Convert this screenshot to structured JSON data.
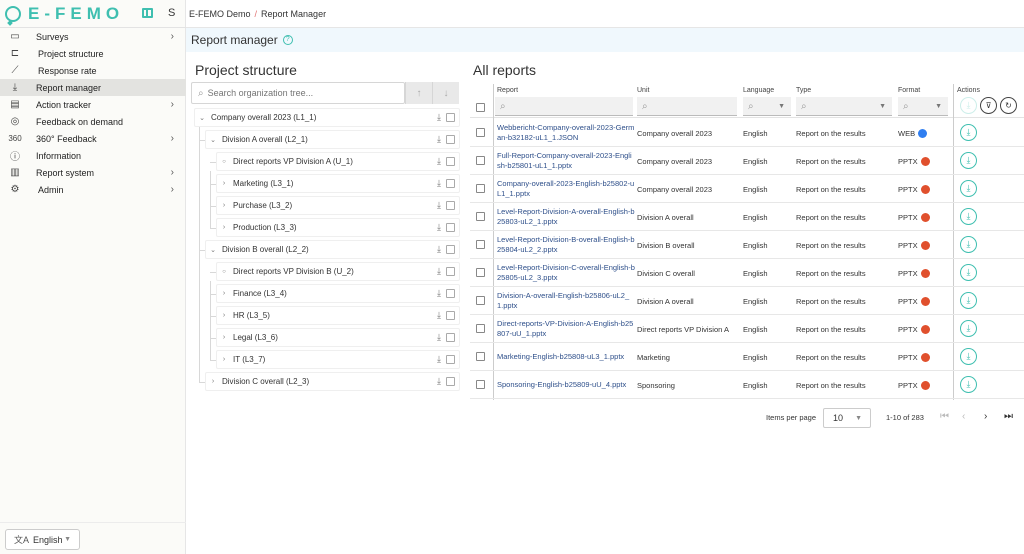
{
  "app": {
    "name": "E-FEMO",
    "user_initial": "S"
  },
  "breadcrumb": {
    "root": "E-FEMO Demo",
    "separator": "/",
    "current": "Report Manager"
  },
  "page_title": "Report manager",
  "sidebar": {
    "items": [
      {
        "label": "Surveys",
        "icon": "folder-icon",
        "has_children": true,
        "active": false
      },
      {
        "label": "Project structure",
        "icon": "hierarchy-icon",
        "has_children": false,
        "active": false
      },
      {
        "label": "Response rate",
        "icon": "line-chart-icon",
        "has_children": false,
        "active": false
      },
      {
        "label": "Report manager",
        "icon": "download-tray-icon",
        "has_children": false,
        "active": true
      },
      {
        "label": "Action tracker",
        "icon": "clipboard-icon",
        "has_children": true,
        "active": false
      },
      {
        "label": "Feedback on demand",
        "icon": "chat-bubbles-icon",
        "has_children": false,
        "active": false
      },
      {
        "label": "360° Feedback",
        "icon": "360-icon",
        "has_children": true,
        "active": false
      },
      {
        "label": "Information",
        "icon": "info-icon",
        "has_children": false,
        "active": false
      },
      {
        "label": "Report system",
        "icon": "bar-chart-icon",
        "has_children": true,
        "active": false
      },
      {
        "label": "Admin",
        "icon": "gear-icon",
        "has_children": true,
        "active": false
      }
    ],
    "language": "English"
  },
  "project_structure": {
    "title": "Project structure",
    "search_placeholder": "Search organization tree...",
    "nodes": [
      {
        "label": "Company overall 2023 (L1_1)",
        "level": 0,
        "state": "expanded"
      },
      {
        "label": "Division A overall (L2_1)",
        "level": 1,
        "state": "expanded"
      },
      {
        "label": "Direct reports VP Division A (U_1)",
        "level": 2,
        "state": "leaf"
      },
      {
        "label": "Marketing (L3_1)",
        "level": 2,
        "state": "collapsed"
      },
      {
        "label": "Purchase (L3_2)",
        "level": 2,
        "state": "collapsed"
      },
      {
        "label": "Production (L3_3)",
        "level": 2,
        "state": "collapsed"
      },
      {
        "label": "Division B overall (L2_2)",
        "level": 1,
        "state": "expanded"
      },
      {
        "label": "Direct reports VP Division B (U_2)",
        "level": 2,
        "state": "leaf"
      },
      {
        "label": "Finance (L3_4)",
        "level": 2,
        "state": "collapsed"
      },
      {
        "label": "HR (L3_5)",
        "level": 2,
        "state": "collapsed"
      },
      {
        "label": "Legal (L3_6)",
        "level": 2,
        "state": "collapsed"
      },
      {
        "label": "IT (L3_7)",
        "level": 2,
        "state": "collapsed"
      },
      {
        "label": "Division C overall (L2_3)",
        "level": 1,
        "state": "collapsed"
      }
    ]
  },
  "all_reports": {
    "title": "All reports",
    "columns": {
      "report": "Report",
      "unit": "Unit",
      "language": "Language",
      "type": "Type",
      "format": "Format",
      "actions": "Actions"
    },
    "rows": [
      {
        "report": "Webbericht-Company-overall-2023-German-b32182-uL1_1.JSON",
        "unit": "Company overall 2023",
        "language": "English",
        "type": "Report on the results",
        "format": "WEB"
      },
      {
        "report": "Full-Report-Company-overall-2023-English-b25801-uL1_1.pptx",
        "unit": "Company overall 2023",
        "language": "English",
        "type": "Report on the results",
        "format": "PPTX"
      },
      {
        "report": "Company-overall-2023-English-b25802-uL1_1.pptx",
        "unit": "Company overall 2023",
        "language": "English",
        "type": "Report on the results",
        "format": "PPTX"
      },
      {
        "report": "Level-Report-Division-A-overall-English-b25803-uL2_1.pptx",
        "unit": "Division A overall",
        "language": "English",
        "type": "Report on the results",
        "format": "PPTX"
      },
      {
        "report": "Level-Report-Division-B-overall-English-b25804-uL2_2.pptx",
        "unit": "Division B overall",
        "language": "English",
        "type": "Report on the results",
        "format": "PPTX"
      },
      {
        "report": "Level-Report-Division-C-overall-English-b25805-uL2_3.pptx",
        "unit": "Division C overall",
        "language": "English",
        "type": "Report on the results",
        "format": "PPTX"
      },
      {
        "report": "Division-A-overall-English-b25806-uL2_1.pptx",
        "unit": "Division A overall",
        "language": "English",
        "type": "Report on the results",
        "format": "PPTX"
      },
      {
        "report": "Direct-reports-VP-Division-A-English-b25807-uU_1.pptx",
        "unit": "Direct reports VP Division A",
        "language": "English",
        "type": "Report on the results",
        "format": "PPTX"
      },
      {
        "report": "Marketing-English-b25808-uL3_1.pptx",
        "unit": "Marketing",
        "language": "English",
        "type": "Report on the results",
        "format": "PPTX"
      },
      {
        "report": "Sponsoring-English-b25809-uU_4.pptx",
        "unit": "Sponsoring",
        "language": "English",
        "type": "Report on the results",
        "format": "PPTX"
      }
    ],
    "pagination": {
      "items_per_page_label": "Items per page",
      "items_per_page": "10",
      "range": "1-10 of 283"
    }
  },
  "colors": {
    "brand": "#3fbfb0",
    "link": "#2e4f8a",
    "web_icon": "#2f7ef0",
    "pptx_icon": "#e0502d"
  }
}
